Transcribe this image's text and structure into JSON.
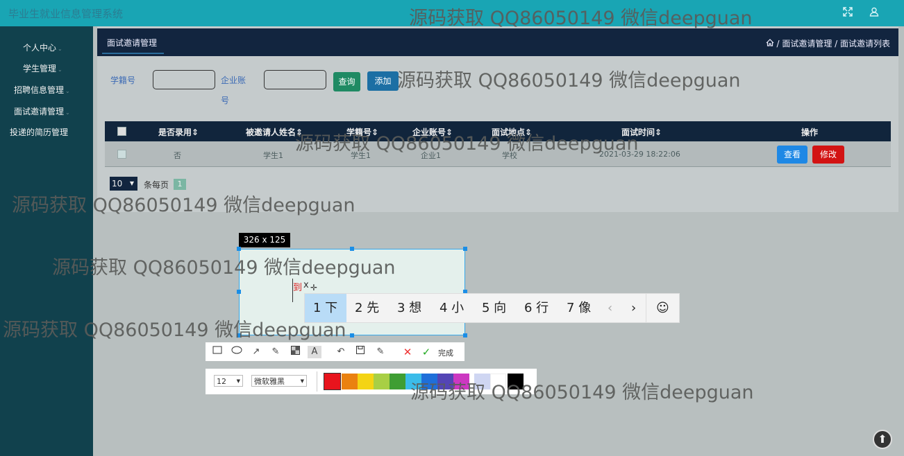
{
  "app": {
    "title": "毕业生就业信息管理系统",
    "expand_icon": "expand-icon",
    "user_icon": "user-icon"
  },
  "sidebar": {
    "items": [
      {
        "label": "个人中心"
      },
      {
        "label": "学生管理"
      },
      {
        "label": "招聘信息管理"
      },
      {
        "label": "面试邀请管理"
      },
      {
        "label": "投递的简历管理"
      }
    ]
  },
  "breadcrumb": {
    "tab": "面试邀请管理",
    "path": "/ 面试邀请管理 / 面试邀请列表"
  },
  "search": {
    "student_label": "学籍号",
    "company_label_1": "企业账",
    "company_label_2": "号",
    "query_btn": "查询",
    "add_btn": "添加",
    "student_value": "",
    "company_value": ""
  },
  "table": {
    "headers": [
      "是否录用⇕",
      "被邀请人姓名⇕",
      "学籍号⇕",
      "企业账号⇕",
      "面试地点⇕",
      "面试时间⇕",
      "操作"
    ],
    "rows": [
      {
        "hired": "否",
        "name": "学生1",
        "student_no": "学生1",
        "company": "企业1",
        "place": "学校",
        "time": "2021-03-29 18:22:06",
        "view": "查看",
        "edit": "修改"
      }
    ]
  },
  "pager": {
    "page_size": "10",
    "per_page_label": "条每页",
    "current_page": "1"
  },
  "screenshot_tool": {
    "size_label": "326 x 125",
    "text_typed": "到",
    "text_typed2": "x",
    "ime_candidates": [
      "1 下",
      "2 先",
      "3 想",
      "4 小",
      "5 向",
      "6 行",
      "7 像"
    ],
    "done_label": "完成",
    "font_size": "12",
    "font_name": "微软雅黑",
    "colors": [
      "#e8141d",
      "#ea8110",
      "#f4d414",
      "#a8cf45",
      "#3f9e33",
      "#3bbce9",
      "#1f6fd9",
      "#5445b5",
      "#cc38c1",
      "#cfd6f2",
      "#ffffff",
      "#000000"
    ]
  },
  "watermark": "源码获取 QQ86050149 微信deepguan",
  "scroll_top_icon": "arrow-up-icon"
}
